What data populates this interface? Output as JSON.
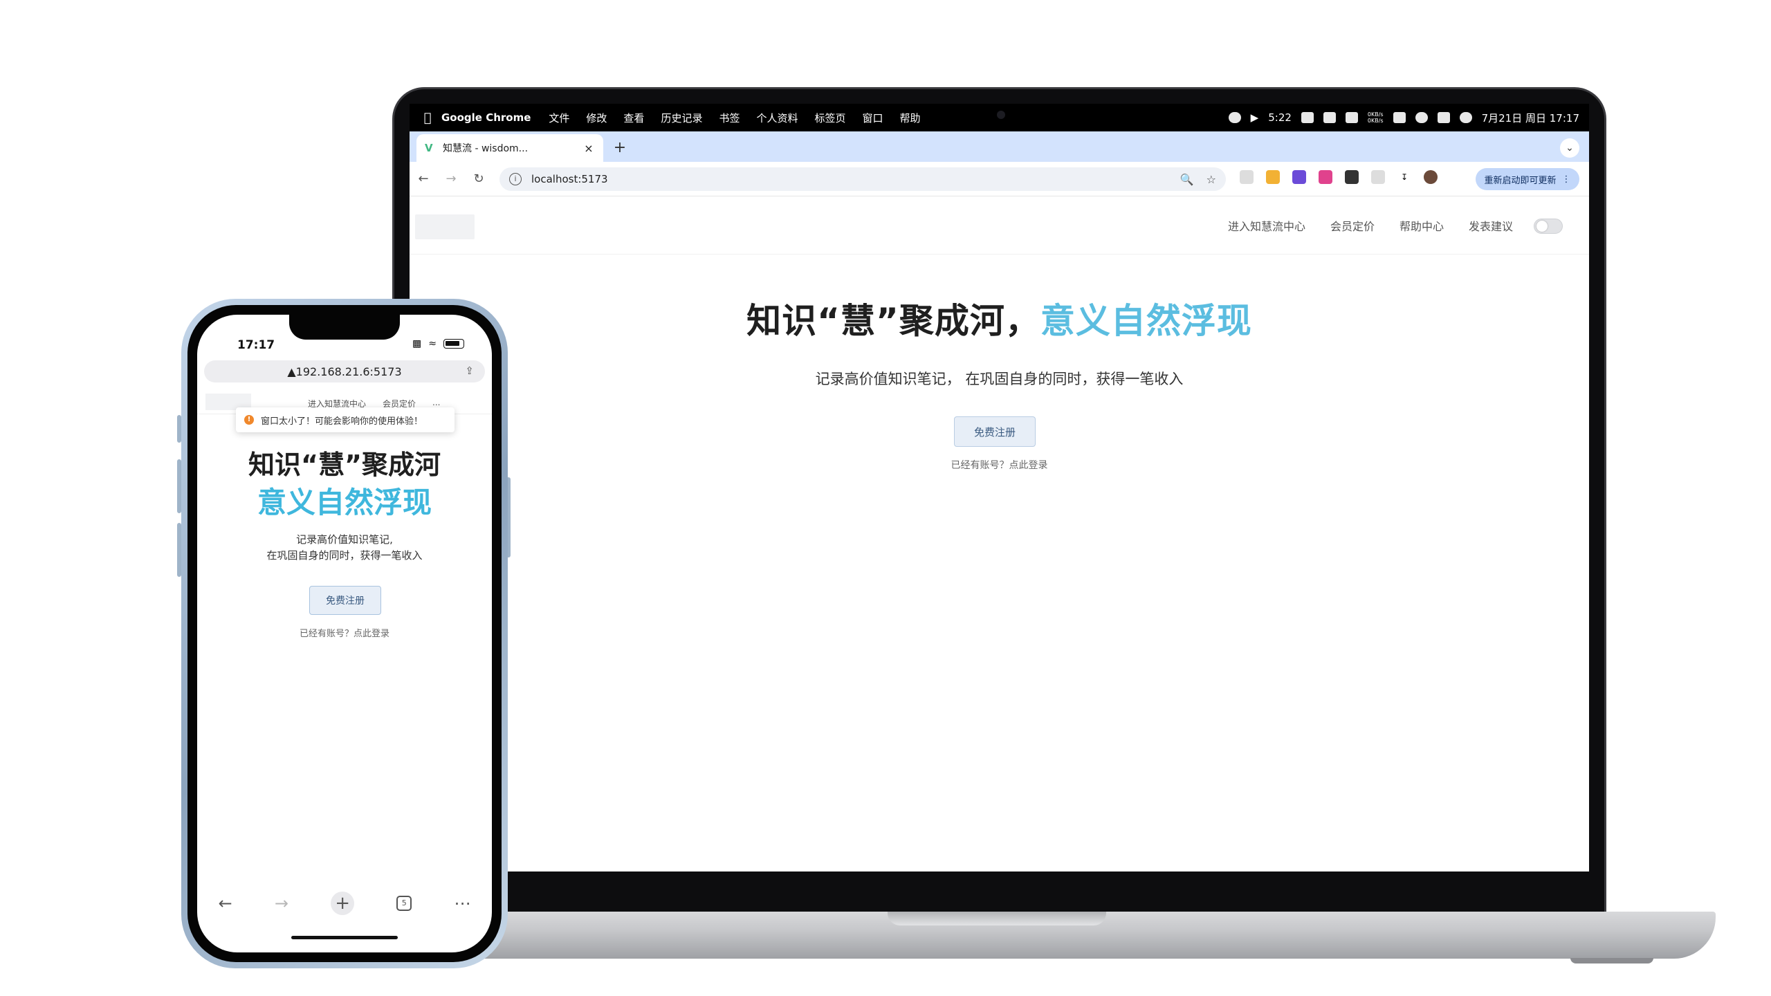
{
  "menubar": {
    "app_name": "Google Chrome",
    "items": [
      "文件",
      "修改",
      "查看",
      "历史记录",
      "书签",
      "个人资料",
      "标签页",
      "窗口",
      "帮助"
    ],
    "netspeed_up": "0KB/s",
    "netspeed_down": "0KB/s",
    "timer": "5:22",
    "datetime": "7月21日 周日  17:17"
  },
  "browser": {
    "tab_title": "知慧流 - wisdom...",
    "url": "localhost:5173",
    "relaunch_label": "重新启动即可更新"
  },
  "site": {
    "nav": [
      "进入知慧流中心",
      "会员定价",
      "帮助中心",
      "发表建议"
    ],
    "hero_title_main": "知识“慧”聚成河，",
    "hero_title_accent": "意义自然浮现",
    "hero_subtitle": "记录高价值知识笔记， 在巩固自身的同时，获得一笔收入",
    "register_button": "免费注册",
    "login_hint": "已经有账号？点此登录"
  },
  "phone": {
    "time": "17:17",
    "url": "▲192.168.21.6:5173",
    "nav": [
      "进入知慧流中心",
      "会员定价",
      "..."
    ],
    "toast": "窗口太小了！可能会影响你的使用体验！",
    "title_line1": "知识“慧”聚成河",
    "title_line2": "意义自然浮现",
    "subtitle_line1": "记录高价值知识笔记,",
    "subtitle_line2": "在巩固自身的同时，获得一笔收入",
    "register_button": "免费注册",
    "login_hint": "已经有账号？点此登录",
    "tab_count": "5"
  },
  "colors": {
    "accent": "#5bbde0",
    "phone_accent": "#3fb7dd",
    "button_bg": "#e7eef7",
    "tabstrip": "#d3e3fd"
  },
  "icons": {
    "apple": "apple-logo-icon",
    "back": "back-arrow-icon",
    "forward": "forward-arrow-icon",
    "reload": "reload-icon",
    "zoom": "zoom-icon",
    "bookmark": "star-icon",
    "download": "download-icon",
    "share": "share-icon",
    "warn": "warning-icon"
  }
}
